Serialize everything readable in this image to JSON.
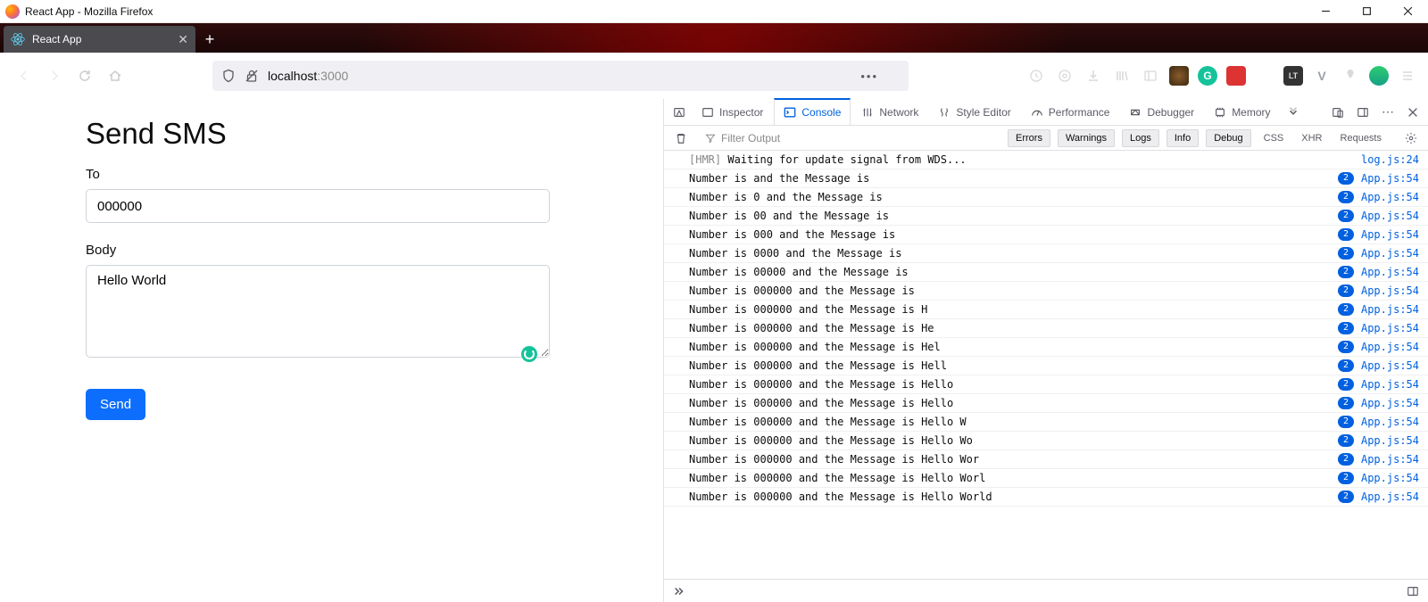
{
  "window": {
    "title": "React App - Mozilla Firefox"
  },
  "tab": {
    "title": "React App"
  },
  "url": {
    "host": "localhost",
    "port": ":3000"
  },
  "page": {
    "heading": "Send SMS",
    "to_label": "To",
    "to_value": "000000",
    "body_label": "Body",
    "body_value": "Hello World",
    "send_label": "Send"
  },
  "devtools": {
    "tabs": {
      "inspector": "Inspector",
      "console": "Console",
      "network": "Network",
      "style": "Style Editor",
      "perf": "Performance",
      "debugger": "Debugger",
      "memory": "Memory"
    },
    "filter_placeholder": "Filter Output",
    "levels": {
      "errors": "Errors",
      "warnings": "Warnings",
      "logs": "Logs",
      "info": "Info",
      "debug": "Debug"
    },
    "extra": {
      "css": "CSS",
      "xhr": "XHR",
      "requests": "Requests"
    },
    "logs": [
      {
        "msg": "[HMR] Waiting for update signal from WDS...",
        "src": "log.js:24",
        "count": null
      },
      {
        "msg": "Number is  and the Message is ",
        "src": "App.js:54",
        "count": 2
      },
      {
        "msg": "Number is 0 and the Message is ",
        "src": "App.js:54",
        "count": 2
      },
      {
        "msg": "Number is 00 and the Message is ",
        "src": "App.js:54",
        "count": 2
      },
      {
        "msg": "Number is 000 and the Message is ",
        "src": "App.js:54",
        "count": 2
      },
      {
        "msg": "Number is 0000 and the Message is ",
        "src": "App.js:54",
        "count": 2
      },
      {
        "msg": "Number is 00000 and the Message is ",
        "src": "App.js:54",
        "count": 2
      },
      {
        "msg": "Number is 000000 and the Message is ",
        "src": "App.js:54",
        "count": 2
      },
      {
        "msg": "Number is 000000 and the Message is H",
        "src": "App.js:54",
        "count": 2
      },
      {
        "msg": "Number is 000000 and the Message is He",
        "src": "App.js:54",
        "count": 2
      },
      {
        "msg": "Number is 000000 and the Message is Hel",
        "src": "App.js:54",
        "count": 2
      },
      {
        "msg": "Number is 000000 and the Message is Hell",
        "src": "App.js:54",
        "count": 2
      },
      {
        "msg": "Number is 000000 and the Message is Hello",
        "src": "App.js:54",
        "count": 2
      },
      {
        "msg": "Number is 000000 and the Message is Hello ",
        "src": "App.js:54",
        "count": 2
      },
      {
        "msg": "Number is 000000 and the Message is Hello W",
        "src": "App.js:54",
        "count": 2
      },
      {
        "msg": "Number is 000000 and the Message is Hello Wo",
        "src": "App.js:54",
        "count": 2
      },
      {
        "msg": "Number is 000000 and the Message is Hello Wor",
        "src": "App.js:54",
        "count": 2
      },
      {
        "msg": "Number is 000000 and the Message is Hello Worl",
        "src": "App.js:54",
        "count": 2
      },
      {
        "msg": "Number is 000000 and the Message is Hello World",
        "src": "App.js:54",
        "count": 2
      }
    ]
  }
}
